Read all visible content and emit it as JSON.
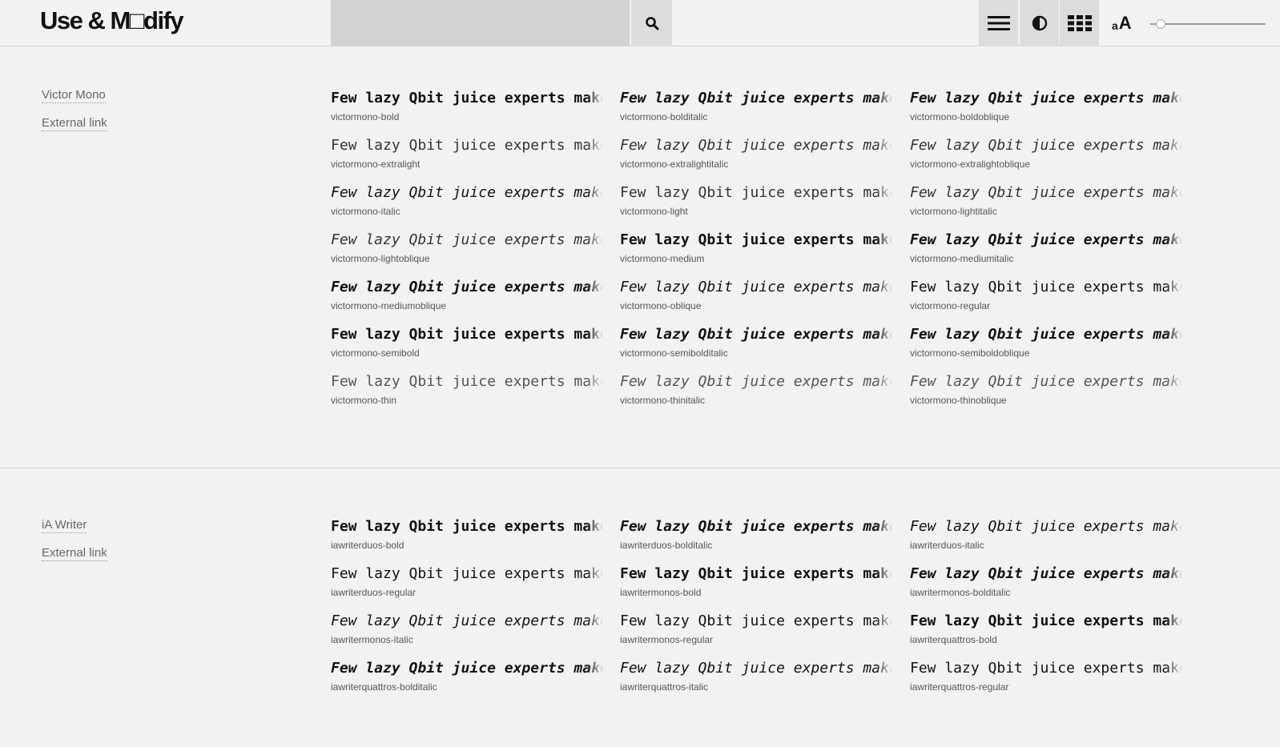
{
  "header": {
    "logo": "Use & M□dify",
    "search": {
      "value": "",
      "placeholder": ""
    },
    "icons": {
      "search": "search-icon",
      "menu": "hamburger-icon",
      "contrast": "contrast-icon",
      "grid": "grid-icon",
      "text_size": "text-size-icon"
    },
    "text_size": {
      "small": "a",
      "big": "A"
    },
    "size_slider": {
      "value": 0.05
    }
  },
  "sections": [
    {
      "links": [
        "Victor Mono",
        "External link"
      ],
      "sample_text": "Few lazy Qbit juice experts make dog",
      "fonts": [
        "victormono-bold",
        "victormono-bolditalic",
        "victormono-boldoblique",
        "victormono-extralight",
        "victormono-extralightitalic",
        "victormono-extralightoblique",
        "victormono-italic",
        "victormono-light",
        "victormono-lightitalic",
        "victormono-lightoblique",
        "victormono-medium",
        "victormono-mediumitalic",
        "victormono-mediumoblique",
        "victormono-oblique",
        "victormono-regular",
        "victormono-semibold",
        "victormono-semibolditalic",
        "victormono-semiboldoblique",
        "victormono-thin",
        "victormono-thinitalic",
        "victormono-thinoblique"
      ]
    },
    {
      "links": [
        "iA Writer",
        "External link"
      ],
      "sample_text": "Few lazy Qbit juice experts make dog",
      "fonts": [
        "iawriterduos-bold",
        "iawriterduos-bolditalic",
        "iawriterduos-italic",
        "iawriterduos-regular",
        "iawritermonos-bold",
        "iawritermonos-bolditalic",
        "iawritermonos-italic",
        "iawritermonos-regular",
        "iawriterquattros-bold",
        "iawriterquattros-bolditalic",
        "iawriterquattros-italic",
        "iawriterquattros-regular"
      ]
    }
  ]
}
